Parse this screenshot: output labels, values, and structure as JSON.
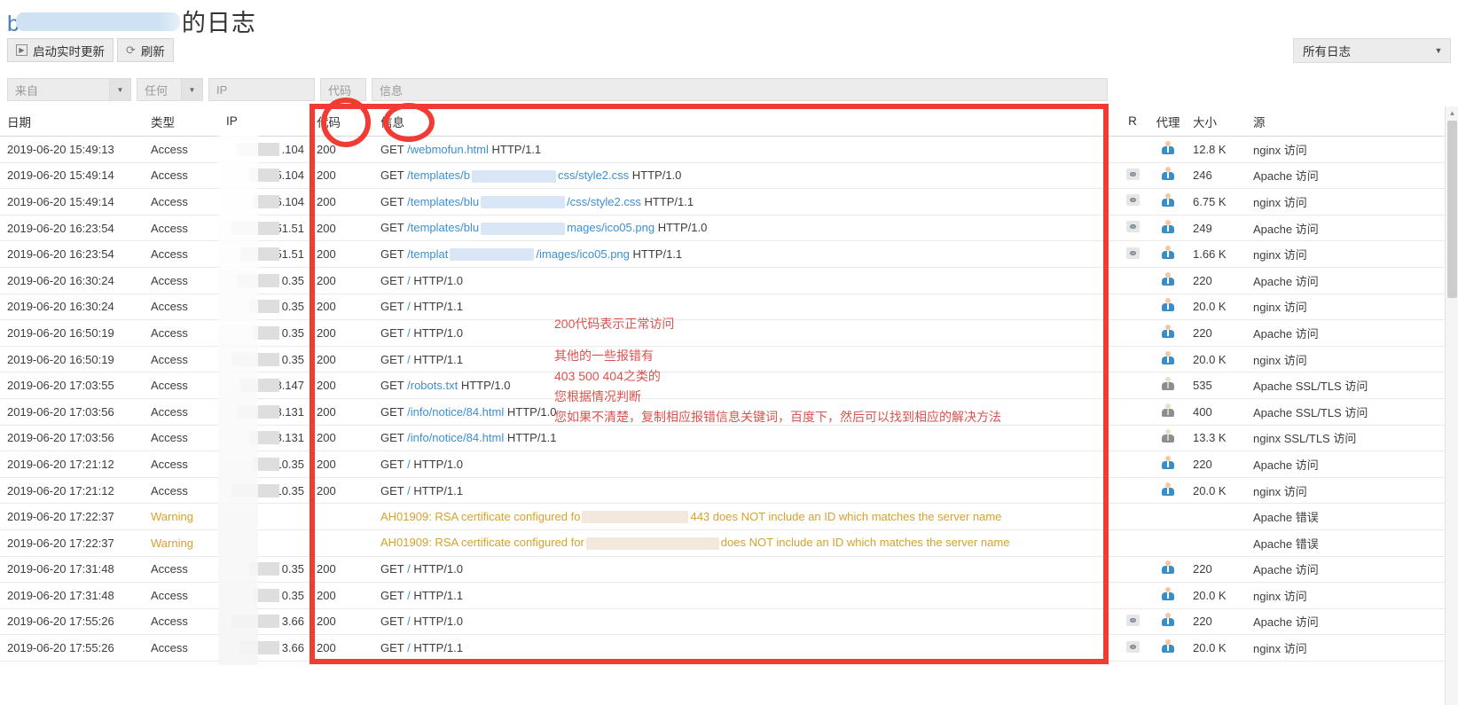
{
  "header": {
    "title_lead": "b",
    "title_suffix": "的日志",
    "toolbar": {
      "start_realtime_label": "启动实时更新",
      "refresh_label": "刷新"
    },
    "log_filter_select": {
      "value": "所有日志",
      "caret": "▼"
    }
  },
  "filters": {
    "from": {
      "placeholder": "来自",
      "caret": "▼"
    },
    "any": {
      "placeholder": "任何",
      "caret": "▼"
    },
    "ip": {
      "placeholder": "IP"
    },
    "code": {
      "placeholder": "代码"
    },
    "message": {
      "placeholder": "信息"
    }
  },
  "table": {
    "columns": [
      "日期",
      "类型",
      "IP",
      "代码",
      "信息",
      "R",
      "代理",
      "大小",
      "源"
    ],
    "rows": [
      {
        "date": "2019-06-20 15:49:13",
        "type": "Access",
        "ip": ".104",
        "code": "200",
        "method": "GET",
        "path": "/webmofun.html",
        "proto": "HTTP/1.1",
        "r": "",
        "agent": "user",
        "size": "12.8 K",
        "src": "nginx 访问"
      },
      {
        "date": "2019-06-20 15:49:14",
        "type": "Access",
        "ip": "5.104",
        "code": "200",
        "method": "GET",
        "path": "/templates/b",
        "path2": "css/style2.css",
        "proto": "HTTP/1.0",
        "r": "eye",
        "agent": "user",
        "size": "246",
        "src": "Apache 访问"
      },
      {
        "date": "2019-06-20 15:49:14",
        "type": "Access",
        "ip": "36.104",
        "code": "200",
        "method": "GET",
        "path": "/templates/blu",
        "path2": "/css/style2.css",
        "proto": "HTTP/1.1",
        "r": "eye",
        "agent": "user",
        "size": "6.75 K",
        "src": "nginx 访问"
      },
      {
        "date": "2019-06-20 16:23:54",
        "type": "Access",
        "ip": "151.51",
        "code": "200",
        "method": "GET",
        "path": "/templates/blu",
        "path2": "mages/ico05.png",
        "proto": "HTTP/1.0",
        "r": "eye",
        "agent": "user",
        "size": "249",
        "src": "Apache 访问"
      },
      {
        "date": "2019-06-20 16:23:54",
        "type": "Access",
        "ip": "51.51",
        "code": "200",
        "method": "GET",
        "path": "/templat",
        "path2": "/images/ico05.png",
        "proto": "HTTP/1.1",
        "r": "eye",
        "agent": "user",
        "size": "1.66 K",
        "src": "nginx 访问"
      },
      {
        "date": "2019-06-20 16:30:24",
        "type": "Access",
        "ip": "0.35",
        "code": "200",
        "method": "GET",
        "path": "/",
        "proto": "HTTP/1.0",
        "r": "",
        "agent": "user",
        "size": "220",
        "src": "Apache 访问"
      },
      {
        "date": "2019-06-20 16:30:24",
        "type": "Access",
        "ip": "0.35",
        "code": "200",
        "method": "GET",
        "path": "/",
        "proto": "HTTP/1.1",
        "r": "",
        "agent": "user",
        "size": "20.0 K",
        "src": "nginx 访问"
      },
      {
        "date": "2019-06-20 16:50:19",
        "type": "Access",
        "ip": "0.35",
        "code": "200",
        "method": "GET",
        "path": "/",
        "proto": "HTTP/1.0",
        "r": "",
        "agent": "user",
        "size": "220",
        "src": "Apache 访问"
      },
      {
        "date": "2019-06-20 16:50:19",
        "type": "Access",
        "ip": "0.35",
        "code": "200",
        "method": "GET",
        "path": "/",
        "proto": "HTTP/1.1",
        "r": "",
        "agent": "user",
        "size": "20.0 K",
        "src": "nginx 访问"
      },
      {
        "date": "2019-06-20 17:03:55",
        "type": "Access",
        "ip": "68.147",
        "code": "200",
        "method": "GET",
        "path": "/robots.txt",
        "proto": "HTTP/1.0",
        "r": "",
        "agent": "bot",
        "size": "535",
        "src": "Apache SSL/TLS 访问"
      },
      {
        "date": "2019-06-20 17:03:56",
        "type": "Access",
        "ip": "68.131",
        "code": "200",
        "method": "GET",
        "path": "/info/notice/84.html",
        "proto": "HTTP/1.0",
        "r": "",
        "agent": "bot",
        "size": "400",
        "src": "Apache SSL/TLS 访问"
      },
      {
        "date": "2019-06-20 17:03:56",
        "type": "Access",
        "ip": "168.131",
        "code": "200",
        "method": "GET",
        "path": "/info/notice/84.html",
        "proto": "HTTP/1.1",
        "r": "",
        "agent": "bot",
        "size": "13.3 K",
        "src": "nginx SSL/TLS 访问"
      },
      {
        "date": "2019-06-20 17:21:12",
        "type": "Access",
        "ip": "110.35",
        "code": "200",
        "method": "GET",
        "path": "/",
        "proto": "HTTP/1.0",
        "r": "",
        "agent": "user",
        "size": "220",
        "src": "Apache 访问"
      },
      {
        "date": "2019-06-20 17:21:12",
        "type": "Access",
        "ip": "110.35",
        "code": "200",
        "method": "GET",
        "path": "/",
        "proto": "HTTP/1.1",
        "r": "",
        "agent": "user",
        "size": "20.0 K",
        "src": "nginx 访问"
      },
      {
        "date": "2019-06-20 17:22:37",
        "type": "Warning",
        "ip": "",
        "code": "",
        "warn_pre": "AH01909: RSA certificate configured fo",
        "warn_post": "443 does NOT include an ID which matches the server name",
        "r": "",
        "agent": "",
        "size": "",
        "src": "Apache 错误"
      },
      {
        "date": "2019-06-20 17:22:37",
        "type": "Warning",
        "ip": "",
        "code": "",
        "warn_pre": "AH01909: RSA certificate configured for",
        "warn_post": "does NOT include an ID which matches the server name",
        "r": "",
        "agent": "",
        "size": "",
        "src": "Apache 错误"
      },
      {
        "date": "2019-06-20 17:31:48",
        "type": "Access",
        "ip": "0.35",
        "code": "200",
        "method": "GET",
        "path": "/",
        "proto": "HTTP/1.0",
        "r": "",
        "agent": "user",
        "size": "220",
        "src": "Apache 访问"
      },
      {
        "date": "2019-06-20 17:31:48",
        "type": "Access",
        "ip": "0.35",
        "code": "200",
        "method": "GET",
        "path": "/",
        "proto": "HTTP/1.1",
        "r": "",
        "agent": "user",
        "size": "20.0 K",
        "src": "nginx 访问"
      },
      {
        "date": "2019-06-20 17:55:26",
        "type": "Access",
        "ip": "3.66",
        "code": "200",
        "method": "GET",
        "path": "/",
        "proto": "HTTP/1.0",
        "r": "eye",
        "agent": "user",
        "size": "220",
        "src": "Apache 访问"
      },
      {
        "date": "2019-06-20 17:55:26",
        "type": "Access",
        "ip": "3.66",
        "code": "200",
        "method": "GET",
        "path": "/",
        "proto": "HTTP/1.1",
        "r": "eye",
        "agent": "user",
        "size": "20.0 K",
        "src": "nginx 访问"
      }
    ]
  },
  "annotations": {
    "color": "#d9534f",
    "box_color": "#f23b33",
    "note_line_1": "200代码表示正常访问",
    "note_line_2": "其他的一些报错有",
    "note_line_3": "403  500  404之类的",
    "note_line_4": "您根据情况判断",
    "note_line_5": "您如果不清楚，复制相应报错信息关键词，百度下，然后可以找到相应的解决方法"
  },
  "scrollbar": {
    "up_arrow": "▲"
  }
}
